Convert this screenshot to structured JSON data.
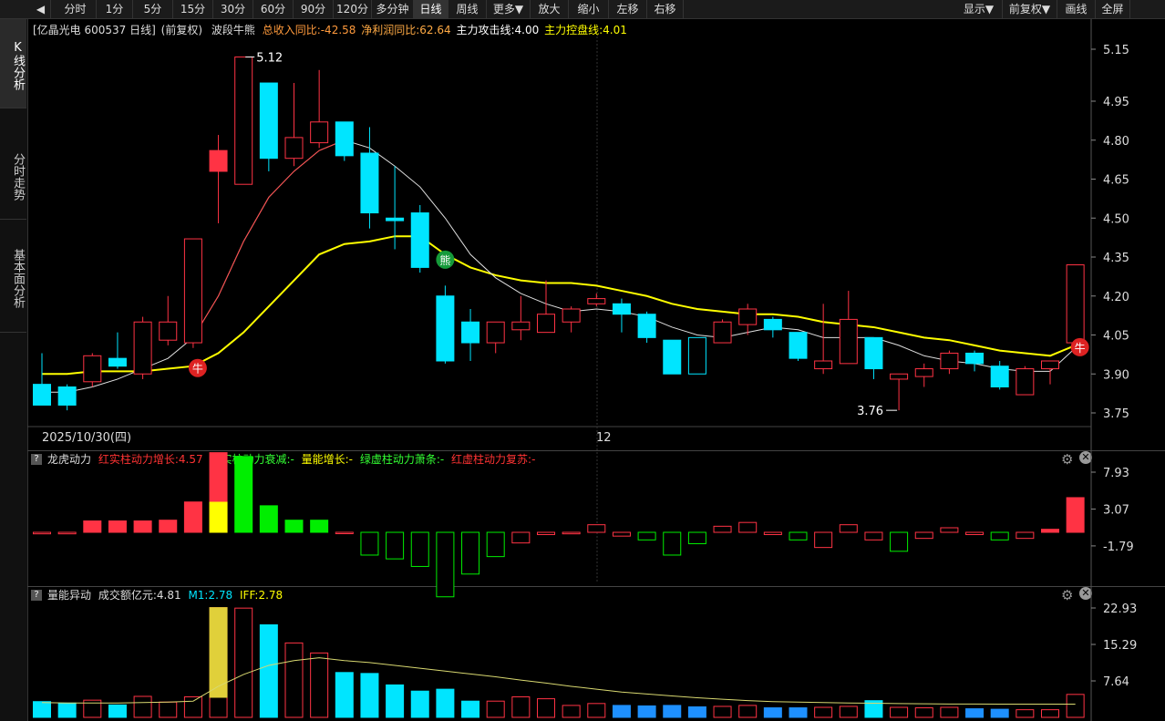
{
  "toolbar": {
    "back_glyph": "◀",
    "items": [
      "分时",
      "1分",
      "5分",
      "15分",
      "30分",
      "60分",
      "90分",
      "120分",
      "多分钟",
      "日线",
      "周线",
      "更多▼",
      "放大",
      "缩小",
      "左移",
      "右移"
    ],
    "right_items": [
      "显示▼",
      "前复权▼",
      "画线",
      "全屏"
    ],
    "active": "日线"
  },
  "sidebar": {
    "tabs": [
      "K线分析",
      "分时走势",
      "基本面分析"
    ]
  },
  "main": {
    "stock_label": "[亿晶光电 600537 日线]",
    "adjust": "(前复权)",
    "indicator_name": "波段牛熊",
    "revenue_yoy": "总收入同比:-42.58",
    "profit_yoy": "净利润同比:62.64",
    "attack_line": "主力攻击线:4.00",
    "control_line": "主力控盘线:4.01",
    "high_label": "5.12",
    "low_label": "3.76",
    "date_label": "2025/10/30(四)",
    "month_label": "12",
    "bull_glyph": "牛",
    "bear_glyph": "熊",
    "y_ticks": [
      "5.15",
      "4.95",
      "4.80",
      "4.65",
      "4.50",
      "4.35",
      "4.20",
      "4.05",
      "3.90",
      "3.75"
    ]
  },
  "panel2": {
    "name": "龙虎动力",
    "l1": "红实柱动力增长:4.57",
    "l2": "绿实柱动力衰减:-",
    "l3": "量能增长:-",
    "l4": "绿虚柱动力萧条:-",
    "l5": "红虚柱动力复苏:-",
    "y_ticks": [
      "7.93",
      "3.07",
      "-1.79"
    ]
  },
  "panel3": {
    "name": "量能异动",
    "amount": "成交额亿元:4.81",
    "m1": "M1:2.78",
    "iff": "IFF:2.78",
    "y_ticks": [
      "22.93",
      "15.29",
      "7.64"
    ]
  },
  "colors": {
    "up": "#ff3344",
    "down": "#00e5ff",
    "yellow": "#ffff00",
    "green": "#00ee00",
    "volume_blue": "#1e90ff",
    "vol_yellow": "#e0d03a"
  },
  "chart_data": {
    "type": "candlestick",
    "candles": [
      {
        "o": 3.86,
        "h": 3.98,
        "l": 3.78,
        "c": 3.78
      },
      {
        "o": 3.85,
        "h": 3.86,
        "l": 3.76,
        "c": 3.78
      },
      {
        "o": 3.87,
        "h": 3.98,
        "l": 3.85,
        "c": 3.97
      },
      {
        "o": 3.96,
        "h": 4.06,
        "l": 3.92,
        "c": 3.93
      },
      {
        "o": 3.9,
        "h": 4.12,
        "l": 3.88,
        "c": 4.1
      },
      {
        "o": 4.03,
        "h": 4.2,
        "l": 4.01,
        "c": 4.1
      },
      {
        "o": 4.02,
        "h": 4.42,
        "l": 4.0,
        "c": 4.42
      },
      {
        "o": 4.68,
        "h": 4.82,
        "l": 4.48,
        "c": 4.76
      },
      {
        "o": 4.63,
        "h": 5.12,
        "l": 4.63,
        "c": 5.12
      },
      {
        "o": 5.02,
        "h": 5.02,
        "l": 4.68,
        "c": 4.73
      },
      {
        "o": 4.73,
        "h": 5.02,
        "l": 4.7,
        "c": 4.81
      },
      {
        "o": 4.79,
        "h": 5.07,
        "l": 4.77,
        "c": 4.87
      },
      {
        "o": 4.87,
        "h": 4.87,
        "l": 4.72,
        "c": 4.74
      },
      {
        "o": 4.75,
        "h": 4.85,
        "l": 4.46,
        "c": 4.52
      },
      {
        "o": 4.5,
        "h": 4.7,
        "l": 4.38,
        "c": 4.49
      },
      {
        "o": 4.52,
        "h": 4.55,
        "l": 4.29,
        "c": 4.31
      },
      {
        "o": 4.2,
        "h": 4.24,
        "l": 3.94,
        "c": 3.95
      },
      {
        "o": 4.1,
        "h": 4.15,
        "l": 3.95,
        "c": 4.02
      },
      {
        "o": 4.02,
        "h": 4.1,
        "l": 3.98,
        "c": 4.1
      },
      {
        "o": 4.07,
        "h": 4.2,
        "l": 4.03,
        "c": 4.1
      },
      {
        "o": 4.06,
        "h": 4.26,
        "l": 4.06,
        "c": 4.13
      },
      {
        "o": 4.1,
        "h": 4.16,
        "l": 4.06,
        "c": 4.15
      },
      {
        "o": 4.17,
        "h": 4.21,
        "l": 4.16,
        "c": 4.19
      },
      {
        "o": 4.17,
        "h": 4.19,
        "l": 4.06,
        "c": 4.13
      },
      {
        "o": 4.13,
        "h": 4.14,
        "l": 4.02,
        "c": 4.04
      },
      {
        "o": 4.03,
        "h": 4.03,
        "l": 3.9,
        "c": 3.9
      },
      {
        "o": 4.04,
        "h": 4.04,
        "l": 3.9,
        "c": 3.9
      },
      {
        "o": 4.02,
        "h": 4.11,
        "l": 4.02,
        "c": 4.1
      },
      {
        "o": 4.09,
        "h": 4.17,
        "l": 4.05,
        "c": 4.15
      },
      {
        "o": 4.11,
        "h": 4.12,
        "l": 4.04,
        "c": 4.07
      },
      {
        "o": 4.06,
        "h": 4.06,
        "l": 3.95,
        "c": 3.96
      },
      {
        "o": 3.92,
        "h": 4.17,
        "l": 3.9,
        "c": 3.95
      },
      {
        "o": 3.94,
        "h": 4.22,
        "l": 3.94,
        "c": 4.11
      },
      {
        "o": 4.04,
        "h": 4.04,
        "l": 3.88,
        "c": 3.92
      },
      {
        "o": 3.88,
        "h": 3.9,
        "l": 3.76,
        "c": 3.9
      },
      {
        "o": 3.89,
        "h": 3.94,
        "l": 3.85,
        "c": 3.92
      },
      {
        "o": 3.92,
        "h": 3.99,
        "l": 3.9,
        "c": 3.98
      },
      {
        "o": 3.98,
        "h": 3.99,
        "l": 3.91,
        "c": 3.94
      },
      {
        "o": 3.93,
        "h": 3.95,
        "l": 3.84,
        "c": 3.85
      },
      {
        "o": 3.82,
        "h": 3.93,
        "l": 3.82,
        "c": 3.92
      },
      {
        "o": 3.92,
        "h": 3.95,
        "l": 3.86,
        "c": 3.95
      },
      {
        "o": 4.02,
        "h": 4.32,
        "l": 4.02,
        "c": 4.32
      }
    ],
    "attack_line": [
      3.83,
      3.83,
      3.85,
      3.88,
      3.92,
      3.96,
      4.04,
      4.2,
      4.41,
      4.58,
      4.68,
      4.76,
      4.8,
      4.77,
      4.7,
      4.62,
      4.5,
      4.36,
      4.27,
      4.21,
      4.17,
      4.14,
      4.15,
      4.14,
      4.12,
      4.08,
      4.05,
      4.04,
      4.06,
      4.08,
      4.07,
      4.04,
      4.04,
      4.04,
      4.01,
      3.97,
      3.95,
      3.94,
      3.92,
      3.91,
      3.91,
      4.0
    ],
    "control_line": [
      3.9,
      3.9,
      3.91,
      3.91,
      3.91,
      3.92,
      3.93,
      3.98,
      4.06,
      4.16,
      4.26,
      4.36,
      4.4,
      4.41,
      4.43,
      4.43,
      4.36,
      4.31,
      4.28,
      4.26,
      4.25,
      4.25,
      4.24,
      4.22,
      4.2,
      4.17,
      4.15,
      4.14,
      4.13,
      4.13,
      4.12,
      4.1,
      4.09,
      4.08,
      4.06,
      4.04,
      4.03,
      4.01,
      3.99,
      3.98,
      3.97,
      4.01
    ],
    "bull_markers": [
      6,
      41
    ],
    "bear_markers": [
      16
    ],
    "dragon_bars": [
      -0.2,
      -0.2,
      1.5,
      1.5,
      1.5,
      1.6,
      4.0,
      10.5,
      10.0,
      3.5,
      1.6,
      1.6,
      -0.1,
      -3.0,
      -3.5,
      -4.5,
      -8.5,
      -5.5,
      -3.2,
      -1.4,
      -0.3,
      -0.2,
      1.0,
      -0.5,
      -1.0,
      -3.0,
      -1.5,
      0.8,
      1.3,
      -0.3,
      -1.0,
      -2.0,
      1.0,
      -1.0,
      -2.5,
      -0.8,
      0.6,
      -0.3,
      -1.0,
      -0.8,
      0.4,
      4.57
    ],
    "dragon_yellow_index": 7,
    "volumes": [
      3.3,
      3.0,
      3.6,
      2.6,
      4.4,
      3.2,
      4.3,
      23.0,
      22.9,
      19.4,
      15.6,
      13.5,
      9.4,
      9.2,
      6.8,
      5.5,
      5.9,
      3.4,
      3.4,
      4.3,
      3.9,
      2.5,
      2.9,
      2.5,
      2.4,
      2.5,
      2.2,
      2.3,
      2.5,
      2.0,
      2.0,
      2.1,
      2.3,
      3.5,
      2.1,
      2.0,
      2.1,
      1.8,
      1.7,
      1.6,
      1.6,
      4.81
    ],
    "m1_line": [
      3.1,
      3.0,
      3.0,
      3.0,
      3.1,
      3.2,
      3.4,
      6.5,
      9.0,
      10.9,
      11.9,
      12.5,
      11.9,
      11.5,
      10.9,
      10.3,
      9.7,
      9.1,
      8.5,
      7.8,
      7.2,
      6.5,
      5.9,
      5.3,
      4.9,
      4.5,
      4.1,
      3.8,
      3.5,
      3.3,
      3.2,
      3.1,
      3.0,
      2.95,
      2.9,
      2.85,
      2.8,
      2.8,
      2.78,
      2.78,
      2.78,
      2.78
    ]
  }
}
